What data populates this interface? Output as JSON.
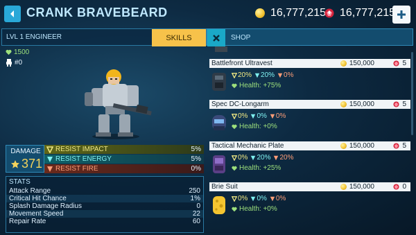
{
  "header": {
    "title": "CRANK BRAVEBEARD",
    "coins": "16,777,215",
    "gems": "16,777,215"
  },
  "colors": {
    "accent": "#29a8d8",
    "skills": "#f7c24a",
    "health": "#9de07c",
    "impact": "#eee783",
    "energy": "#7ff0f0",
    "fire": "#ff9e78"
  },
  "unit": {
    "level_class": "LVL 1 ENGINEER",
    "skills_label": "SKILLS",
    "health": "1500",
    "count": "#0",
    "damage_label": "DAMAGE",
    "damage_value": "371",
    "resists": [
      {
        "label": "RESIST IMPACT",
        "value": "5%"
      },
      {
        "label": "RESIST ENERGY",
        "value": "5%"
      },
      {
        "label": "RESIST FIRE",
        "value": "0%"
      }
    ],
    "stats_title": "STATS",
    "stats": [
      {
        "name": "Attack Range",
        "value": "250"
      },
      {
        "name": "Critical Hit Chance",
        "value": "1%"
      },
      {
        "name": "Splash Damage Radius",
        "value": "0"
      },
      {
        "name": "Movement Speed",
        "value": "22"
      },
      {
        "name": "Repair Rate",
        "value": "60"
      }
    ]
  },
  "shop": {
    "title": "SHOP",
    "items": [
      {
        "name": "Battlefront Ultravest",
        "price": "150,000",
        "gems": "5",
        "impact": "20%",
        "energy": "20%",
        "fire": "0%",
        "bonus": "Health: +75%"
      },
      {
        "name": "Spec DC-Longarm",
        "price": "150,000",
        "gems": "5",
        "impact": "0%",
        "energy": "0%",
        "fire": "0%",
        "bonus": "Health: +0%"
      },
      {
        "name": "Tactical Mechanic Plate",
        "price": "150,000",
        "gems": "5",
        "impact": "0%",
        "energy": "20%",
        "fire": "20%",
        "bonus": "Health: +25%"
      },
      {
        "name": "Brie Suit",
        "price": "150,000",
        "gems": "0",
        "impact": "0%",
        "energy": "0%",
        "fire": "0%",
        "bonus": "Health: +0%"
      }
    ]
  }
}
